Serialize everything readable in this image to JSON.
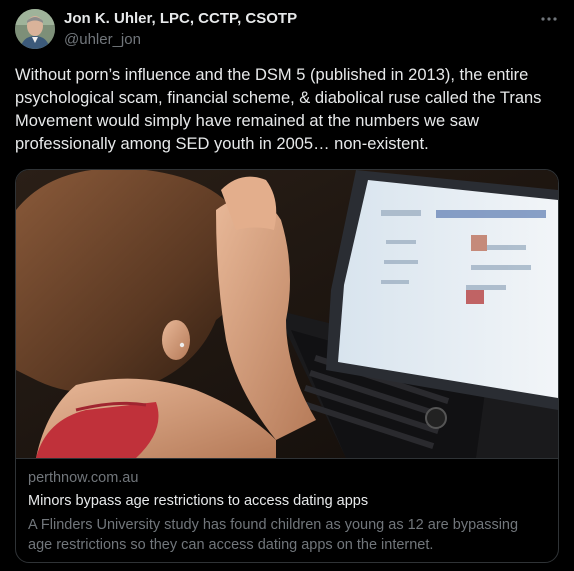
{
  "author": {
    "name": "Jon K. Uhler, LPC, CCTP, CSOTP",
    "handle": "@uhler_jon"
  },
  "icons": {
    "more": "more-horizontal-icon"
  },
  "tweet": {
    "text": "Without porn’s influence and the DSM 5 (published in 2013), the entire psychological scam, financial scheme, & diabolical ruse called the Trans Movement would simply have remained at the numbers we saw professionally among SED youth in 2005… non-existent."
  },
  "card": {
    "domain": "perthnow.com.au",
    "title": "Minors bypass age restrictions to access dating apps",
    "description": "A Flinders University study has found children as young as 12 are bypassing age restrictions so they can access dating apps on the internet."
  },
  "colors": {
    "background": "#000000",
    "text_primary": "#e7e9ea",
    "text_secondary": "#71767b",
    "border": "#2f3336"
  }
}
